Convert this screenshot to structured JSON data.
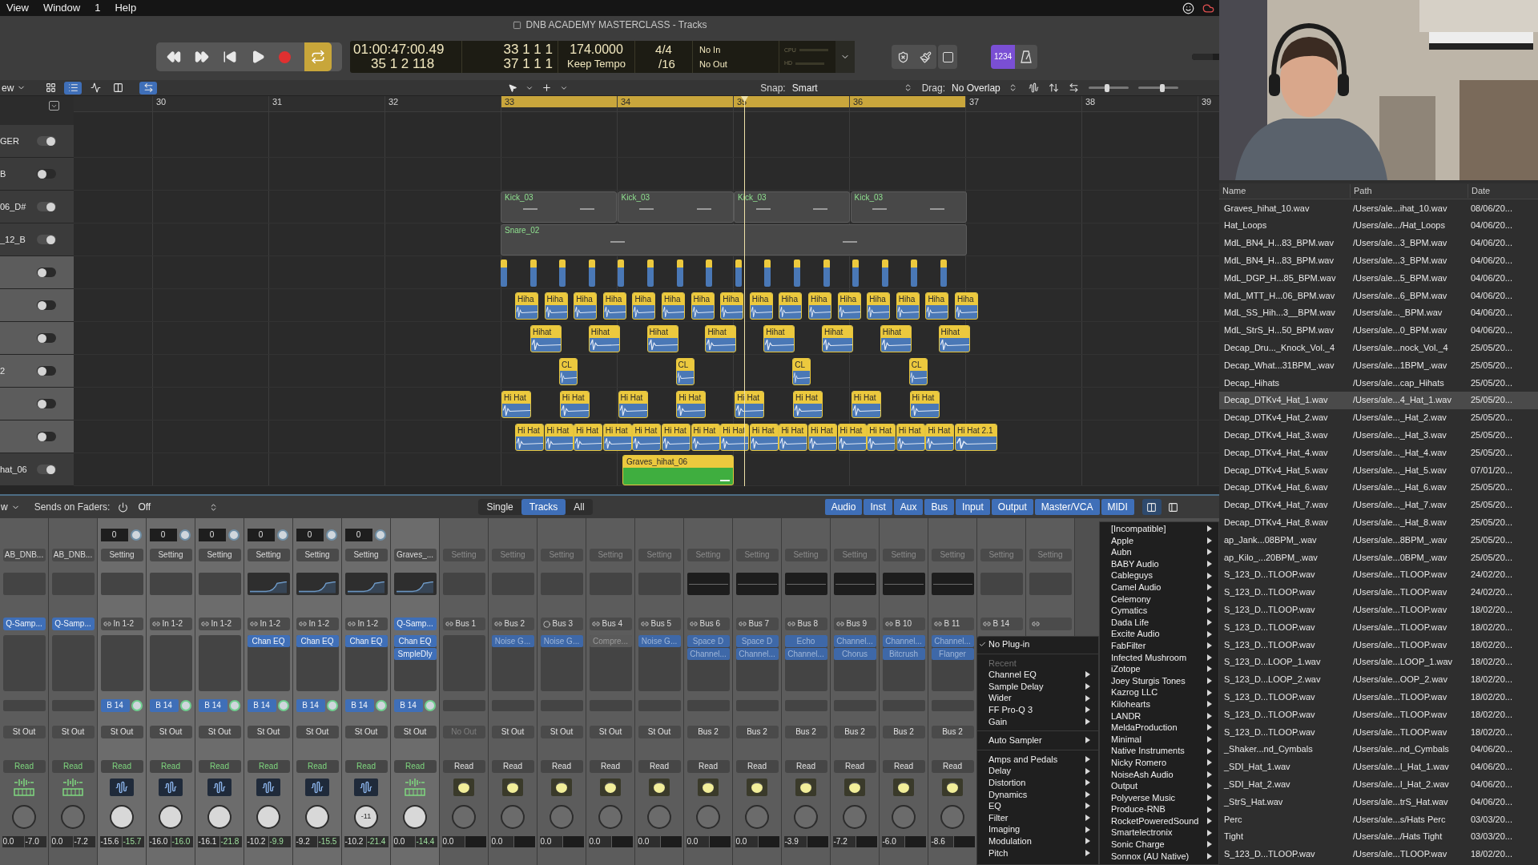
{
  "menu_bar": [
    "View",
    "Window",
    "1",
    "Help"
  ],
  "window": {
    "title": "DNB ACADEMY MASTERCLASS - Tracks"
  },
  "transport": {
    "cycle_on": true
  },
  "lcd": {
    "time": "01:00:47:00.49",
    "position": "35 1 2 118",
    "cycle_start": "33 1 1 1",
    "cycle_end": "37 1 1 1",
    "tempo": "174.0000",
    "tempo_mode": "Keep Tempo",
    "signature": "4/4",
    "division": "/16",
    "midi_in": "No In",
    "midi_out": "No Out",
    "meters": [
      "CPU",
      "HD"
    ]
  },
  "count_in": {
    "label": "1234",
    "on": true
  },
  "master_volume": {
    "level": 0.75
  },
  "tracks_toolbar": {
    "view_menu": "ew",
    "view_buttons": [
      {
        "selected": false
      },
      {
        "selected": true
      },
      {
        "selected": false
      },
      {
        "selected": false
      },
      {
        "selected": true
      }
    ],
    "snap_label": "Snap:",
    "snap": "Smart",
    "drag_label": "Drag:",
    "drag": "No Overlap",
    "vertical_zoom": {
      "level": 0.45
    },
    "horizontal_zoom": {
      "level": 0.6
    }
  },
  "ruler": [
    "30",
    "31",
    "32",
    "33",
    "34",
    "35",
    "36",
    "37",
    "38",
    "39"
  ],
  "tracks": [
    {
      "name": "GER",
      "selected": false,
      "on": true
    },
    {
      "name": "B",
      "selected": false,
      "on": false
    },
    {
      "name": "06_D#",
      "selected": false,
      "on": true,
      "regions": [
        {
          "kind": "audio",
          "label": "Kick_03"
        },
        {
          "kind": "audio",
          "label": "Kick_03"
        },
        {
          "kind": "audio",
          "label": "Kick_03"
        },
        {
          "kind": "audio",
          "label": "Kick_03"
        }
      ]
    },
    {
      "name": "_12_B",
      "selected": false,
      "on": true,
      "regions": [
        {
          "kind": "audio",
          "label": "Snare_02"
        }
      ]
    },
    {
      "selected": true,
      "on": false,
      "regions": [
        {
          "kind": "slice"
        },
        {
          "kind": "slice"
        },
        {
          "kind": "slice"
        },
        {
          "kind": "slice"
        },
        {
          "kind": "slice"
        },
        {
          "kind": "slice"
        },
        {
          "kind": "slice"
        },
        {
          "kind": "slice"
        },
        {
          "kind": "slice"
        },
        {
          "kind": "slice"
        },
        {
          "kind": "slice"
        },
        {
          "kind": "slice"
        },
        {
          "kind": "slice"
        },
        {
          "kind": "slice"
        },
        {
          "kind": "slice"
        },
        {
          "kind": "slice"
        }
      ]
    },
    {
      "selected": true,
      "on": false,
      "regions": [
        {
          "kind": "hihat",
          "label": "Hiha"
        },
        {
          "kind": "hihat",
          "label": "Hiha"
        },
        {
          "kind": "hihat",
          "label": "Hiha"
        },
        {
          "kind": "hihat",
          "label": "Hiha"
        },
        {
          "kind": "hihat",
          "label": "Hiha"
        },
        {
          "kind": "hihat",
          "label": "Hiha"
        },
        {
          "kind": "hihat",
          "label": "Hiha"
        },
        {
          "kind": "hihat",
          "label": "Hiha"
        },
        {
          "kind": "hihat",
          "label": "Hiha"
        },
        {
          "kind": "hihat",
          "label": "Hiha"
        },
        {
          "kind": "hihat",
          "label": "Hiha"
        },
        {
          "kind": "hihat",
          "label": "Hiha"
        },
        {
          "kind": "hihat",
          "label": "Hiha"
        },
        {
          "kind": "hihat",
          "label": "Hiha"
        },
        {
          "kind": "hihat",
          "label": "Hiha"
        },
        {
          "kind": "hihat",
          "label": "Hiha"
        }
      ]
    },
    {
      "selected": true,
      "on": false,
      "regions": [
        {
          "kind": "hihat",
          "label": "Hihat"
        },
        {
          "kind": "hihat",
          "label": "Hihat"
        },
        {
          "kind": "hihat",
          "label": "Hihat"
        },
        {
          "kind": "hihat",
          "label": "Hihat"
        },
        {
          "kind": "hihat",
          "label": "Hihat"
        },
        {
          "kind": "hihat",
          "label": "Hihat"
        },
        {
          "kind": "hihat",
          "label": "Hihat"
        },
        {
          "kind": "hihat",
          "label": "Hihat"
        }
      ]
    },
    {
      "name": "2",
      "selected": true,
      "on": false,
      "regions": [
        {
          "kind": "hihat",
          "label": "CL"
        },
        {
          "kind": "hihat",
          "label": "CL"
        },
        {
          "kind": "hihat",
          "label": "CL"
        },
        {
          "kind": "hihat",
          "label": "CL"
        }
      ]
    },
    {
      "selected": true,
      "on": false,
      "regions": [
        {
          "kind": "hihat",
          "label": "Hi Hat"
        },
        {
          "kind": "hihat",
          "label": "Hi Hat"
        },
        {
          "kind": "hihat",
          "label": "Hi Hat"
        },
        {
          "kind": "hihat",
          "label": "Hi Hat"
        },
        {
          "kind": "hihat",
          "label": "Hi Hat"
        },
        {
          "kind": "hihat",
          "label": "Hi Hat"
        },
        {
          "kind": "hihat",
          "label": "Hi Hat"
        },
        {
          "kind": "hihat",
          "label": "Hi Hat"
        }
      ]
    },
    {
      "selected": true,
      "on": false,
      "regions": [
        {
          "kind": "hihat",
          "label": "Hi Hat"
        },
        {
          "kind": "hihat",
          "label": "Hi Hat"
        },
        {
          "kind": "hihat",
          "label": "Hi Hat"
        },
        {
          "kind": "hihat",
          "label": "Hi Hat"
        },
        {
          "kind": "hihat",
          "label": "Hi Hat"
        },
        {
          "kind": "hihat",
          "label": "Hi Hat"
        },
        {
          "kind": "hihat",
          "label": "Hi Hat"
        },
        {
          "kind": "hihat",
          "label": "Hi Hat"
        },
        {
          "kind": "hihat",
          "label": "Hi Hat"
        },
        {
          "kind": "hihat",
          "label": "Hi Hat"
        },
        {
          "kind": "hihat",
          "label": "Hi Hat"
        },
        {
          "kind": "hihat",
          "label": "Hi Hat"
        },
        {
          "kind": "hihat",
          "label": "Hi Hat"
        },
        {
          "kind": "hihat",
          "label": "Hi Hat"
        },
        {
          "kind": "hihat",
          "label": "Hi Hat"
        },
        {
          "kind": "hihat",
          "label": "Hi Hat 2.1"
        }
      ]
    },
    {
      "name": "hat_06",
      "selected": false,
      "on": true,
      "regions": [
        {
          "kind": "green",
          "label": "Graves_hihat_06"
        }
      ]
    }
  ],
  "mixer_toolbar": {
    "view_menu": "w",
    "sends_label": "Sends on Faders:",
    "sends_value": "Off",
    "modes": [
      {
        "label": "Single",
        "selected": false
      },
      {
        "label": "Tracks",
        "selected": true
      },
      {
        "label": "All",
        "selected": false
      }
    ],
    "filters": [
      {
        "label": "Audio",
        "selected": true
      },
      {
        "label": "Inst",
        "selected": true
      },
      {
        "label": "Aux",
        "selected": true
      },
      {
        "label": "Bus",
        "selected": true
      },
      {
        "label": "Input",
        "selected": true
      },
      {
        "label": "Output",
        "selected": true
      },
      {
        "label": "Master/VCA",
        "selected": true
      },
      {
        "label": "MIDI",
        "selected": true
      }
    ]
  },
  "strips": [
    {
      "kind": "inst",
      "selected": false,
      "setting": "AB_DNB...",
      "input": {
        "kind": "instrument",
        "label": "Q-Samp..."
      },
      "output": {
        "label": "St Out",
        "disabled": false
      },
      "automation": "Read",
      "volume": "0.0",
      "peak": "-7.0"
    },
    {
      "kind": "inst",
      "selected": false,
      "setting": "AB_DNB...",
      "input": {
        "kind": "instrument",
        "label": "Q-Samp..."
      },
      "output": {
        "label": "St Out",
        "disabled": false
      },
      "automation": "Read",
      "volume": "0.0",
      "peak": "-7.2"
    },
    {
      "kind": "audio",
      "selected": true,
      "gain": "0",
      "setting": "Setting",
      "input": {
        "kind": "stereo",
        "label": "In 1-2"
      },
      "send": "B 14",
      "output": {
        "label": "St Out",
        "disabled": false
      },
      "automation": "Read",
      "volume": "-15.6",
      "peak": "-15.7"
    },
    {
      "kind": "audio",
      "selected": true,
      "gain": "0",
      "setting": "Setting",
      "input": {
        "kind": "stereo",
        "label": "In 1-2"
      },
      "send": "B 14",
      "output": {
        "label": "St Out",
        "disabled": false
      },
      "automation": "Read",
      "volume": "-16.0",
      "peak": "-16.0"
    },
    {
      "kind": "audio",
      "selected": true,
      "gain": "0",
      "setting": "Setting",
      "input": {
        "kind": "stereo",
        "label": "In 1-2"
      },
      "send": "B 14",
      "output": {
        "label": "St Out",
        "disabled": false
      },
      "automation": "Read",
      "volume": "-16.1",
      "peak": "-21.8"
    },
    {
      "kind": "audio",
      "selected": true,
      "gain": "0",
      "setting": "Setting",
      "eq": {
        "kind": "curve"
      },
      "input": {
        "kind": "stereo",
        "label": "In 1-2"
      },
      "plugins": [
        {
          "name": "Chan EQ",
          "on": true
        }
      ],
      "send": "B 14",
      "output": {
        "label": "St Out",
        "disabled": false
      },
      "automation": "Read",
      "volume": "-10.2",
      "peak": "-9.9"
    },
    {
      "kind": "audio",
      "selected": true,
      "gain": "0",
      "setting": "Setting",
      "eq": {
        "kind": "curve"
      },
      "input": {
        "kind": "stereo",
        "label": "In 1-2"
      },
      "plugins": [
        {
          "name": "Chan EQ",
          "on": true
        }
      ],
      "send": "B 14",
      "output": {
        "label": "St Out",
        "disabled": false
      },
      "automation": "Read",
      "volume": "-9.2",
      "peak": "-15.5"
    },
    {
      "kind": "audio",
      "selected": true,
      "gain": "0",
      "setting": "Setting",
      "eq": {
        "kind": "curve"
      },
      "input": {
        "kind": "stereo",
        "label": "In 1-2"
      },
      "plugins": [
        {
          "name": "Chan EQ",
          "on": true
        }
      ],
      "send": "B 14",
      "output": {
        "label": "St Out",
        "disabled": false
      },
      "automation": "Read",
      "pan_reading": "-11",
      "volume": "-10.2",
      "peak": "-21.4"
    },
    {
      "kind": "inst",
      "selected": true,
      "setting": "Graves_...",
      "eq": {
        "kind": "curve"
      },
      "input": {
        "kind": "instrument",
        "label": "Q-Samp..."
      },
      "plugins": [
        {
          "name": "Chan EQ",
          "on": true
        },
        {
          "name": "SmpleDly",
          "on": true
        }
      ],
      "send": "B 14",
      "output": {
        "label": "St Out",
        "disabled": false
      },
      "automation": "Read",
      "volume": "0.0",
      "peak": "-14.4"
    },
    {
      "kind": "aux",
      "selected": false,
      "setting": "Setting",
      "input": {
        "kind": "stereo",
        "label": "Bus 1"
      },
      "output": {
        "label": "No Out",
        "disabled": true
      },
      "automation": "Read",
      "volume": "0.0"
    },
    {
      "kind": "aux",
      "selected": false,
      "setting": "Setting",
      "input": {
        "kind": "stereo",
        "label": "Bus 2"
      },
      "plugins": [
        {
          "name": "Noise G...",
          "on": true
        }
      ],
      "output": {
        "label": "St Out",
        "disabled": false
      },
      "automation": "Read",
      "volume": "0.0"
    },
    {
      "kind": "aux",
      "selected": false,
      "setting": "Setting",
      "input": {
        "kind": "mono",
        "label": "Bus 3"
      },
      "plugins": [
        {
          "name": "Noise G...",
          "on": true
        }
      ],
      "output": {
        "label": "St Out",
        "disabled": false
      },
      "automation": "Read",
      "volume": "0.0"
    },
    {
      "kind": "aux",
      "selected": false,
      "setting": "Setting",
      "input": {
        "kind": "stereo",
        "label": "Bus 4"
      },
      "plugins": [
        {
          "name": "Compre...",
          "on": false
        }
      ],
      "output": {
        "label": "St Out",
        "disabled": false
      },
      "automation": "Read",
      "volume": "0.0"
    },
    {
      "kind": "aux",
      "selected": false,
      "setting": "Setting",
      "input": {
        "kind": "stereo",
        "label": "Bus 5"
      },
      "plugins": [
        {
          "name": "Noise G...",
          "on": true
        }
      ],
      "output": {
        "label": "St Out",
        "disabled": false
      },
      "automation": "Read",
      "volume": "0.0"
    },
    {
      "kind": "aux",
      "selected": false,
      "setting": "Setting",
      "eq": {
        "kind": "flat"
      },
      "input": {
        "kind": "stereo",
        "label": "Bus 6"
      },
      "plugins": [
        {
          "name": "Space D",
          "on": true
        },
        {
          "name": "Channel...",
          "on": true
        }
      ],
      "output": {
        "label": "Bus 2",
        "disabled": false
      },
      "automation": "Read",
      "volume": "0.0"
    },
    {
      "kind": "aux",
      "selected": false,
      "setting": "Setting",
      "eq": {
        "kind": "flat"
      },
      "input": {
        "kind": "stereo",
        "label": "Bus 7"
      },
      "plugins": [
        {
          "name": "Space D",
          "on": true
        },
        {
          "name": "Channel...",
          "on": true
        }
      ],
      "output": {
        "label": "Bus 2",
        "disabled": false
      },
      "automation": "Read",
      "volume": "0.0"
    },
    {
      "kind": "aux",
      "selected": false,
      "setting": "Setting",
      "eq": {
        "kind": "flat"
      },
      "input": {
        "kind": "stereo",
        "label": "Bus 8"
      },
      "plugins": [
        {
          "name": "Echo",
          "on": true
        },
        {
          "name": "Channel...",
          "on": true
        }
      ],
      "output": {
        "label": "Bus 2",
        "disabled": false
      },
      "automation": "Read",
      "volume": "-3.9"
    },
    {
      "kind": "aux",
      "selected": false,
      "setting": "Setting",
      "eq": {
        "kind": "flat"
      },
      "input": {
        "kind": "stereo",
        "label": "Bus 9"
      },
      "plugins": [
        {
          "name": "Channel...",
          "on": true
        },
        {
          "name": "Chorus",
          "on": true
        }
      ],
      "output": {
        "label": "Bus 2",
        "disabled": false
      },
      "automation": "Read",
      "volume": "-7.2"
    },
    {
      "kind": "aux",
      "selected": false,
      "setting": "Setting",
      "eq": {
        "kind": "flat"
      },
      "input": {
        "kind": "stereo",
        "label": "B 10"
      },
      "plugins": [
        {
          "name": "Channel...",
          "on": true
        },
        {
          "name": "Bitcrush",
          "on": true
        }
      ],
      "output": {
        "label": "Bus 2",
        "disabled": false
      },
      "automation": "Read",
      "volume": "-6.0"
    },
    {
      "kind": "aux",
      "selected": false,
      "setting": "Setting",
      "eq": {
        "kind": "flat"
      },
      "input": {
        "kind": "stereo",
        "label": "B 11"
      },
      "plugins": [
        {
          "name": "Channel...",
          "on": true
        },
        {
          "name": "Flanger",
          "on": true
        }
      ],
      "output": {
        "label": "Bus 2",
        "disabled": false
      },
      "automation": "Read",
      "volume": "-8.6"
    },
    {
      "kind": "aux",
      "selected": false,
      "setting": "Setting",
      "input": {
        "kind": "stereo",
        "label": "B 14"
      }
    },
    {
      "kind": "aux",
      "selected": false,
      "setting": "Setting",
      "input": {
        "kind": "stereo"
      }
    }
  ],
  "plugin_menu": [
    {
      "kind": "check",
      "label": "No Plug-in",
      "checked": true
    },
    {
      "kind": "separator"
    },
    {
      "kind": "header",
      "label": "Recent"
    },
    {
      "kind": "submenu",
      "label": "Channel EQ"
    },
    {
      "kind": "submenu",
      "label": "Sample Delay"
    },
    {
      "kind": "submenu",
      "label": "Wider"
    },
    {
      "kind": "submenu",
      "label": "FF Pro-Q 3"
    },
    {
      "kind": "submenu",
      "label": "Gain"
    },
    {
      "kind": "separator"
    },
    {
      "kind": "submenu",
      "label": "Auto Sampler"
    },
    {
      "kind": "separator"
    },
    {
      "kind": "submenu",
      "label": "Amps and Pedals"
    },
    {
      "kind": "submenu",
      "label": "Delay"
    },
    {
      "kind": "submenu",
      "label": "Distortion"
    },
    {
      "kind": "submenu",
      "label": "Dynamics"
    },
    {
      "kind": "submenu",
      "label": "EQ"
    },
    {
      "kind": "submenu",
      "label": "Filter"
    },
    {
      "kind": "submenu",
      "label": "Imaging"
    },
    {
      "kind": "submenu",
      "label": "Modulation"
    },
    {
      "kind": "submenu",
      "label": "Pitch"
    }
  ],
  "manufacturer_menu": [
    "[Incompatible]",
    "Apple",
    "Aubn",
    "BABY Audio",
    "Cableguys",
    "Camel Audio",
    "Celemony",
    "Cymatics",
    "Dada Life",
    "Excite Audio",
    "FabFilter",
    "Infected Mushroom",
    "iZotope",
    "Joey Sturgis Tones",
    "Kazrog LLC",
    "Kilohearts",
    "LANDR",
    "MeldaProduction",
    "Minimal",
    "Native Instruments",
    "Nicky Romero",
    "NoiseAsh Audio",
    "Output",
    "Polyverse Music",
    "Produce-RNB",
    "RocketPoweredSound",
    "Smartelectronix",
    "Sonic Charge",
    "Sonnox (AU Native)"
  ],
  "browser": {
    "columns": [
      "Name",
      "Path",
      "Date"
    ],
    "rows": [
      {
        "name": "Graves_hihat_10.wav",
        "path": "/Users/ale...ihat_10.wav",
        "date": "08/06/20...",
        "selected": false
      },
      {
        "name": "Hat_Loops",
        "path": "/Users/ale.../Hat_Loops",
        "date": "04/06/20...",
        "selected": false
      },
      {
        "name": "MdL_BN4_H...83_BPM.wav",
        "path": "/Users/ale...3_BPM.wav",
        "date": "04/06/20...",
        "selected": false
      },
      {
        "name": "MdL_BN4_H...83_BPM.wav",
        "path": "/Users/ale...3_BPM.wav",
        "date": "04/06/20...",
        "selected": false
      },
      {
        "name": "MdL_DGP_H...85_BPM.wav",
        "path": "/Users/ale...5_BPM.wav",
        "date": "04/06/20...",
        "selected": false
      },
      {
        "name": "MdL_MTT_H...06_BPM.wav",
        "path": "/Users/ale...6_BPM.wav",
        "date": "04/06/20...",
        "selected": false
      },
      {
        "name": "MdL_SS_Hih...3__BPM.wav",
        "path": "/Users/ale..._BPM.wav",
        "date": "04/06/20...",
        "selected": false
      },
      {
        "name": "MdL_StrS_H...50_BPM.wav",
        "path": "/Users/ale...0_BPM.wav",
        "date": "04/06/20...",
        "selected": false
      },
      {
        "name": "Decap_Dru..._Knock_Vol._4",
        "path": "/Users/ale...nock_Vol._4",
        "date": "25/05/20...",
        "selected": false
      },
      {
        "name": "Decap_What...31BPM_.wav",
        "path": "/Users/ale...1BPM_.wav",
        "date": "25/05/20...",
        "selected": false
      },
      {
        "name": "Decap_Hihats",
        "path": "/Users/ale...cap_Hihats",
        "date": "25/05/20...",
        "selected": false
      },
      {
        "name": "Decap_DTKv4_Hat_1.wav",
        "path": "/Users/ale...4_Hat_1.wav",
        "date": "25/05/20...",
        "selected": true
      },
      {
        "name": "Decap_DTKv4_Hat_2.wav",
        "path": "/Users/ale..._Hat_2.wav",
        "date": "25/05/20...",
        "selected": false
      },
      {
        "name": "Decap_DTKv4_Hat_3.wav",
        "path": "/Users/ale..._Hat_3.wav",
        "date": "25/05/20...",
        "selected": false
      },
      {
        "name": "Decap_DTKv4_Hat_4.wav",
        "path": "/Users/ale..._Hat_4.wav",
        "date": "25/05/20...",
        "selected": false
      },
      {
        "name": "Decap_DTKv4_Hat_5.wav",
        "path": "/Users/ale..._Hat_5.wav",
        "date": "07/01/20...",
        "selected": false
      },
      {
        "name": "Decap_DTKv4_Hat_6.wav",
        "path": "/Users/ale..._Hat_6.wav",
        "date": "25/05/20...",
        "selected": false
      },
      {
        "name": "Decap_DTKv4_Hat_7.wav",
        "path": "/Users/ale..._Hat_7.wav",
        "date": "25/05/20...",
        "selected": false
      },
      {
        "name": "Decap_DTKv4_Hat_8.wav",
        "path": "/Users/ale..._Hat_8.wav",
        "date": "25/05/20...",
        "selected": false
      },
      {
        "name": "ap_Jank...08BPM_.wav",
        "path": "/Users/ale...8BPM_.wav",
        "date": "25/05/20...",
        "selected": false
      },
      {
        "name": "ap_Kilo_...20BPM_.wav",
        "path": "/Users/ale...0BPM_.wav",
        "date": "25/05/20...",
        "selected": false
      },
      {
        "name": "S_123_D...TLOOP.wav",
        "path": "/Users/ale...TLOOP.wav",
        "date": "24/02/20...",
        "selected": false
      },
      {
        "name": "S_123_D...TLOOP.wav",
        "path": "/Users/ale...TLOOP.wav",
        "date": "24/02/20...",
        "selected": false
      },
      {
        "name": "S_123_D...TLOOP.wav",
        "path": "/Users/ale...TLOOP.wav",
        "date": "18/02/20...",
        "selected": false
      },
      {
        "name": "S_123_D...TLOOP.wav",
        "path": "/Users/ale...TLOOP.wav",
        "date": "18/02/20...",
        "selected": false
      },
      {
        "name": "S_123_D...TLOOP.wav",
        "path": "/Users/ale...TLOOP.wav",
        "date": "18/02/20...",
        "selected": false
      },
      {
        "name": "S_123_D...LOOP_1.wav",
        "path": "/Users/ale...LOOP_1.wav",
        "date": "18/02/20...",
        "selected": false
      },
      {
        "name": "S_123_D...LOOP_2.wav",
        "path": "/Users/ale...OOP_2.wav",
        "date": "18/02/20...",
        "selected": false
      },
      {
        "name": "S_123_D...TLOOP.wav",
        "path": "/Users/ale...TLOOP.wav",
        "date": "18/02/20...",
        "selected": false
      },
      {
        "name": "S_123_D...TLOOP.wav",
        "path": "/Users/ale...TLOOP.wav",
        "date": "18/02/20...",
        "selected": false
      },
      {
        "name": "S_123_D...TLOOP.wav",
        "path": "/Users/ale...TLOOP.wav",
        "date": "18/02/20...",
        "selected": false
      },
      {
        "name": "_Shaker...nd_Cymbals",
        "path": "/Users/ale...nd_Cymbals",
        "date": "04/06/20...",
        "selected": false
      },
      {
        "name": "_SDI_Hat_1.wav",
        "path": "/Users/ale...I_Hat_1.wav",
        "date": "04/06/20...",
        "selected": false
      },
      {
        "name": "_SDI_Hat_2.wav",
        "path": "/Users/ale...I_Hat_2.wav",
        "date": "04/06/20...",
        "selected": false
      },
      {
        "name": "_StrS_Hat.wav",
        "path": "/Users/ale...trS_Hat.wav",
        "date": "04/06/20...",
        "selected": false
      },
      {
        "name": "Perc",
        "path": "/Users/ale...s/Hats Perc",
        "date": "03/03/20...",
        "selected": false
      },
      {
        "name": "Tight",
        "path": "/Users/ale.../Hats Tight",
        "date": "03/03/20...",
        "selected": false
      },
      {
        "name": "S_123_D...TLOOP.wav",
        "path": "/Users/ale...TLOOP.wav",
        "date": "18/02/20...",
        "selected": false
      }
    ]
  }
}
